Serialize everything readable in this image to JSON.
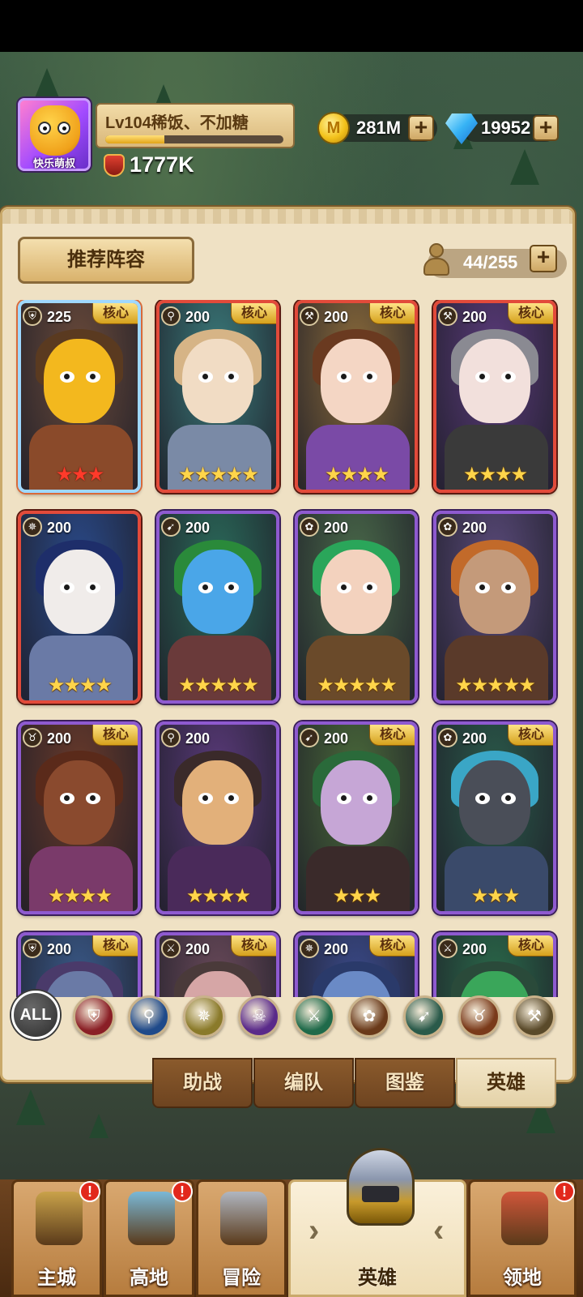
{
  "player": {
    "avatar_name": "快乐萌叔",
    "level_name": "Lv104稀饭、不加糖",
    "xp_fraction": 0.33,
    "power": "1777K"
  },
  "resources": {
    "gold": "281M",
    "gems": "19952",
    "gold_icon": "coin-icon",
    "gem_icon": "diamond-icon"
  },
  "panel": {
    "recommend_label": "推荐阵容",
    "hero_count": "44/255"
  },
  "heroes": [
    {
      "level": "225",
      "core": "核心",
      "class_icon": "shield-icon",
      "stars": 3,
      "star_color": "red",
      "rarity": "rainbow"
    },
    {
      "level": "200",
      "core": "核心",
      "class_icon": "staff-icon",
      "stars": 5,
      "star_color": "gold",
      "rarity": "red"
    },
    {
      "level": "200",
      "core": "核心",
      "class_icon": "hammer-icon",
      "stars": 4,
      "star_color": "gold",
      "rarity": "red"
    },
    {
      "level": "200",
      "core": "核心",
      "class_icon": "hammer-icon",
      "stars": 4,
      "star_color": "gold",
      "rarity": "red"
    },
    {
      "level": "200",
      "core": "",
      "class_icon": "angel-icon",
      "stars": 4,
      "star_color": "gold",
      "rarity": "red"
    },
    {
      "level": "200",
      "core": "",
      "class_icon": "bow-icon",
      "stars": 5,
      "star_color": "gold",
      "rarity": "purple"
    },
    {
      "level": "200",
      "core": "",
      "class_icon": "paw-icon",
      "stars": 5,
      "star_color": "gold",
      "rarity": "purple"
    },
    {
      "level": "200",
      "core": "",
      "class_icon": "paw-icon",
      "stars": 5,
      "star_color": "gold",
      "rarity": "purple"
    },
    {
      "level": "200",
      "core": "核心",
      "class_icon": "bull-icon",
      "stars": 4,
      "star_color": "gold",
      "rarity": "purple"
    },
    {
      "level": "200",
      "core": "",
      "class_icon": "staff-icon",
      "stars": 4,
      "star_color": "gold",
      "rarity": "purple"
    },
    {
      "level": "200",
      "core": "核心",
      "class_icon": "bow-icon",
      "stars": 3,
      "star_color": "gold",
      "rarity": "purple"
    },
    {
      "level": "200",
      "core": "核心",
      "class_icon": "paw-icon",
      "stars": 3,
      "star_color": "gold",
      "rarity": "purple"
    },
    {
      "level": "200",
      "core": "核心",
      "class_icon": "shield-icon",
      "stars": 0,
      "star_color": "gold",
      "rarity": "purple"
    },
    {
      "level": "200",
      "core": "核心",
      "class_icon": "swords-icon",
      "stars": 0,
      "star_color": "gold",
      "rarity": "purple"
    },
    {
      "level": "200",
      "core": "核心",
      "class_icon": "angel-icon",
      "stars": 0,
      "star_color": "gold",
      "rarity": "purple"
    },
    {
      "level": "200",
      "core": "核心",
      "class_icon": "swords-icon",
      "stars": 0,
      "star_color": "gold",
      "rarity": "purple"
    }
  ],
  "filters": {
    "all_label": "ALL",
    "items": [
      {
        "icon": "shield-icon",
        "color": "#8a1f26"
      },
      {
        "icon": "staff-icon",
        "color": "#1f4a8a"
      },
      {
        "icon": "angel-icon",
        "color": "#8a7a2a"
      },
      {
        "icon": "skull-icon",
        "color": "#5a2a8a"
      },
      {
        "icon": "swords-icon",
        "color": "#1f6a4a"
      },
      {
        "icon": "paw-icon",
        "color": "#6a3a1a"
      },
      {
        "icon": "bow-icon",
        "color": "#2a5a4a"
      },
      {
        "icon": "bull-icon",
        "color": "#7a3a1a"
      },
      {
        "icon": "hammer-icon",
        "color": "#5a4a2a"
      }
    ]
  },
  "sub_tabs": [
    "助战",
    "编队",
    "图鉴",
    "英雄"
  ],
  "nav": {
    "items": [
      {
        "label": "主城",
        "alert": "!"
      },
      {
        "label": "高地",
        "alert": "!"
      },
      {
        "label": "冒险",
        "alert": ""
      },
      {
        "label": "英雄",
        "alert": ""
      },
      {
        "label": "领地",
        "alert": "!"
      }
    ]
  },
  "colors": {
    "panel_bg": "#efe1c4",
    "accent_gold": "#d5a11c",
    "alert_red": "#e2281c"
  }
}
